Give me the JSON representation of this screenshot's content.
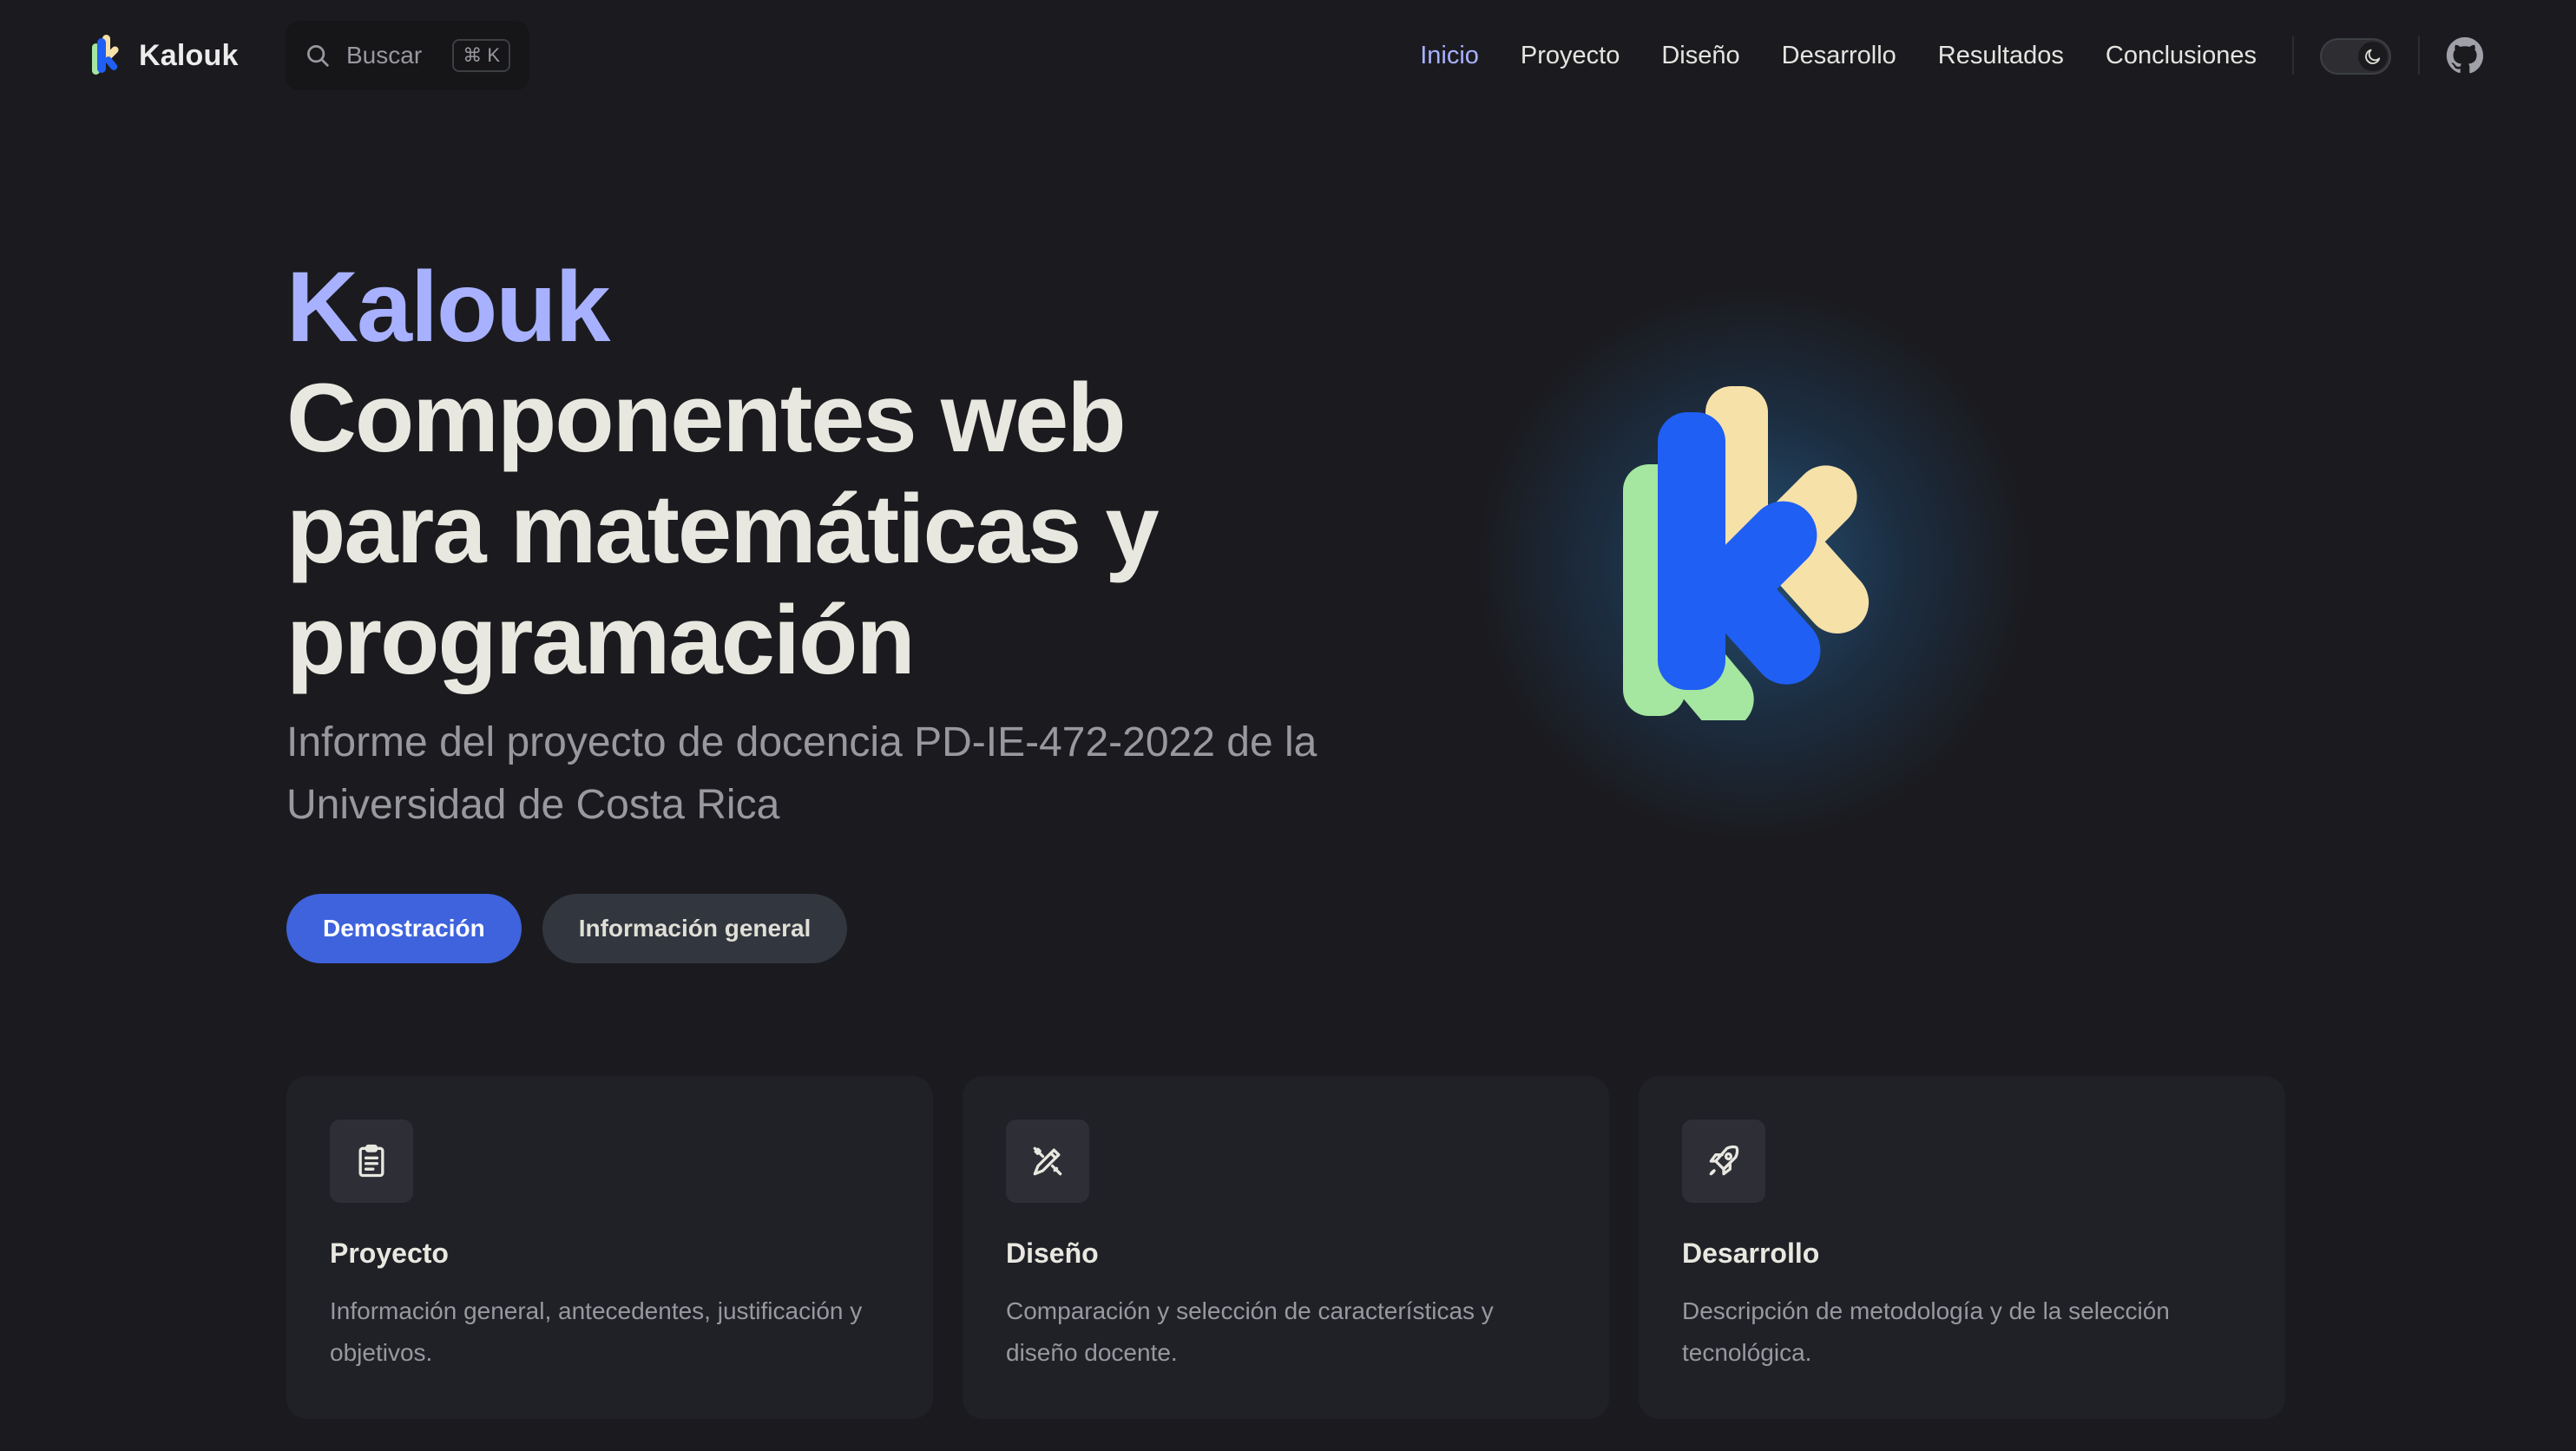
{
  "site": {
    "name": "Kalouk",
    "logo_icon": "kalouk-logo-icon"
  },
  "search": {
    "label": "Buscar",
    "shortcut": "⌘ K",
    "icon": "search-icon"
  },
  "nav": {
    "items": [
      {
        "label": "Inicio",
        "active": true
      },
      {
        "label": "Proyecto",
        "active": false
      },
      {
        "label": "Diseño",
        "active": false
      },
      {
        "label": "Desarrollo",
        "active": false
      },
      {
        "label": "Resultados",
        "active": false
      },
      {
        "label": "Conclusiones",
        "active": false
      }
    ],
    "theme_toggle_icon": "moon-icon",
    "social_icon": "github-icon"
  },
  "hero": {
    "name": "Kalouk",
    "text": "Componentes web para matemáticas y programación",
    "tagline": "Informe del proyecto de docencia PD-IE-472-2022 de la Universidad de Costa Rica",
    "actions": [
      {
        "label": "Demostración",
        "theme": "brand"
      },
      {
        "label": "Información general",
        "theme": "alt"
      }
    ]
  },
  "features": [
    {
      "icon": "clipboard-icon",
      "title": "Proyecto",
      "details": "Información general, antecedentes, justificación y objetivos."
    },
    {
      "icon": "pen-ruler-icon",
      "title": "Diseño",
      "details": "Comparación y selección de características y diseño docente."
    },
    {
      "icon": "rocket-icon",
      "title": "Desarrollo",
      "details": "Descripción de metodología y de la selección tecnológica."
    }
  ],
  "colors": {
    "background": "#1b1b1f",
    "brand": "#3e63dd",
    "accent_text": "#a8b1ff",
    "logo_blue": "#1f5ff4",
    "logo_green": "#a5e6a0",
    "logo_cream": "#f6e1a9"
  }
}
